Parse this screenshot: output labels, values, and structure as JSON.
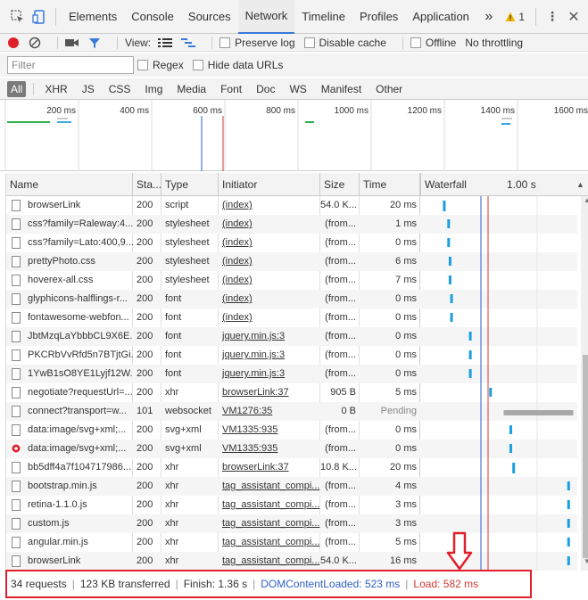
{
  "tabs": [
    "Elements",
    "Console",
    "Sources",
    "Network",
    "Timeline",
    "Profiles",
    "Application"
  ],
  "active_tab": "Network",
  "more_glyph": "»",
  "warning_count": "1",
  "toolbar": {
    "view_label": "View:",
    "preserve_log": "Preserve log",
    "disable_cache": "Disable cache",
    "offline": "Offline",
    "throttling": "No throttling"
  },
  "filter": {
    "placeholder": "Filter",
    "regex": "Regex",
    "hide_data_urls": "Hide data URLs"
  },
  "types": [
    "All",
    "XHR",
    "JS",
    "CSS",
    "Img",
    "Media",
    "Font",
    "Doc",
    "WS",
    "Manifest",
    "Other"
  ],
  "overview_ticks": [
    "200 ms",
    "400 ms",
    "600 ms",
    "800 ms",
    "1000 ms",
    "1200 ms",
    "1400 ms",
    "1600 ms"
  ],
  "columns": {
    "name": "Name",
    "status": "Sta...",
    "type": "Type",
    "initiator": "Initiator",
    "size": "Size",
    "time": "Time",
    "waterfall": "Waterfall",
    "waterfall_tick": "1.00 s"
  },
  "rows": [
    {
      "name": "browserLink",
      "status": "200",
      "type": "script",
      "initiator": "(index)",
      "size": "54.0 K...",
      "time": "20 ms",
      "wf": 0.12
    },
    {
      "name": "css?family=Raleway:4...",
      "status": "200",
      "type": "stylesheet",
      "initiator": "(index)",
      "size": "(from...",
      "time": "1 ms",
      "wf": 0.15
    },
    {
      "name": "css?family=Lato:400,9...",
      "status": "200",
      "type": "stylesheet",
      "initiator": "(index)",
      "size": "(from...",
      "time": "0 ms",
      "wf": 0.15
    },
    {
      "name": "prettyPhoto.css",
      "status": "200",
      "type": "stylesheet",
      "initiator": "(index)",
      "size": "(from...",
      "time": "6 ms",
      "wf": 0.16
    },
    {
      "name": "hoverex-all.css",
      "status": "200",
      "type": "stylesheet",
      "initiator": "(index)",
      "size": "(from...",
      "time": "7 ms",
      "wf": 0.16
    },
    {
      "name": "glyphicons-halflings-r...",
      "status": "200",
      "type": "font",
      "initiator": "(index)",
      "size": "(from...",
      "time": "0 ms",
      "wf": 0.17
    },
    {
      "name": "fontawesome-webfon...",
      "status": "200",
      "type": "font",
      "initiator": "(index)",
      "size": "(from...",
      "time": "0 ms",
      "wf": 0.17
    },
    {
      "name": "JbtMzqLaYbbbCL9X6E...",
      "status": "200",
      "type": "font",
      "initiator": "jquery.min.js:3",
      "size": "(from...",
      "time": "0 ms",
      "wf": 0.3
    },
    {
      "name": "PKCRbVvRfd5n7BTjtGi...",
      "status": "200",
      "type": "font",
      "initiator": "jquery.min.js:3",
      "size": "(from...",
      "time": "0 ms",
      "wf": 0.3
    },
    {
      "name": "1YwB1sO8YE1Lyjf12W...",
      "status": "200",
      "type": "font",
      "initiator": "jquery.min.js:3",
      "size": "(from...",
      "time": "0 ms",
      "wf": 0.3
    },
    {
      "name": "negotiate?requestUrl=...",
      "status": "200",
      "type": "xhr",
      "initiator": "browserLink:37",
      "size": "905 B",
      "time": "5 ms",
      "wf": 0.44
    },
    {
      "name": "connect?transport=w...",
      "status": "101",
      "type": "websocket",
      "initiator": "VM1276:35",
      "size": "0 B",
      "time": "Pending",
      "wf": 0.54
    },
    {
      "name": "data:image/svg+xml;...",
      "status": "200",
      "type": "svg+xml",
      "initiator": "VM1335:935",
      "size": "(from...",
      "time": "0 ms",
      "wf": 0.58
    },
    {
      "name": "data:image/svg+xml;...",
      "status": "200",
      "type": "svg+xml",
      "initiator": "VM1335:935",
      "size": "(from...",
      "time": "0 ms",
      "wf": 0.58
    },
    {
      "name": "bb5dff4a7f104717986...",
      "status": "200",
      "type": "xhr",
      "initiator": "browserLink:37",
      "size": "10.8 K...",
      "time": "20 ms",
      "wf": 0.6
    },
    {
      "name": "bootstrap.min.js",
      "status": "200",
      "type": "xhr",
      "initiator": "tag_assistant_compi...",
      "size": "(from...",
      "time": "4 ms",
      "wf": 0.98
    },
    {
      "name": "retina-1.1.0.js",
      "status": "200",
      "type": "xhr",
      "initiator": "tag_assistant_compi...",
      "size": "(from...",
      "time": "3 ms",
      "wf": 0.98
    },
    {
      "name": "custom.js",
      "status": "200",
      "type": "xhr",
      "initiator": "tag_assistant_compi...",
      "size": "(from...",
      "time": "3 ms",
      "wf": 0.98
    },
    {
      "name": "angular.min.js",
      "status": "200",
      "type": "xhr",
      "initiator": "tag_assistant_compi...",
      "size": "(from...",
      "time": "5 ms",
      "wf": 0.98
    },
    {
      "name": "browserLink",
      "status": "200",
      "type": "xhr",
      "initiator": "tag_assistant_compi...",
      "size": "54.0 K...",
      "time": "16 ms",
      "wf": 0.98
    }
  ],
  "status": {
    "requests": "34 requests",
    "transferred": "123 KB transferred",
    "finish": "Finish: 1.36 s",
    "dom": "DOMContentLoaded: 523 ms",
    "load": "Load: 582 ms"
  },
  "colors": {
    "accent": "#3879d9",
    "dom": "#2f5ec4",
    "load": "#d23a32",
    "highlight": "#e0202a"
  }
}
